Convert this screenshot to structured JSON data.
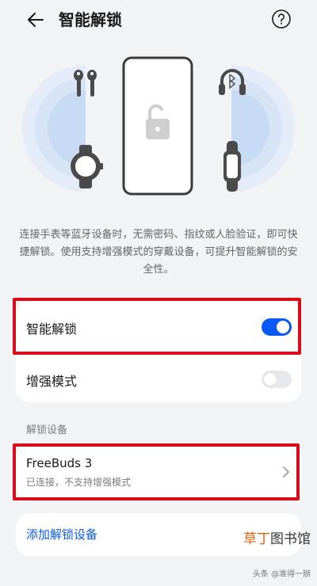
{
  "header": {
    "title": "智能解锁"
  },
  "icons": {
    "back": "arrow-left-icon",
    "help": "question-circle-icon",
    "chevron": "chevron-right-icon"
  },
  "hero": {
    "devices": [
      "earbuds",
      "smartwatch",
      "phone",
      "headphones",
      "band"
    ]
  },
  "description": "连接手表等蓝牙设备时，无需密码、指纹或人脸验证，即可快捷解锁。使用支持增强模式的穿戴设备，可提升智能解锁的安全性。",
  "settings": {
    "smart_unlock": {
      "label": "智能解锁",
      "on": true
    },
    "enhanced_mode": {
      "label": "增强模式",
      "on": false
    }
  },
  "unlock_devices": {
    "section_title": "解锁设备",
    "items": [
      {
        "name": "FreeBuds 3",
        "status": "已连接，不支持增强模式"
      }
    ],
    "add_label": "添加解锁设备"
  },
  "watermark": {
    "brand_part1": "草丁",
    "brand_part2": "图书馆",
    "author": "头条 @准得一辦"
  },
  "colors": {
    "accent": "#0a59f7",
    "annotation": "#d90c1a",
    "background": "#f1f3f5"
  }
}
